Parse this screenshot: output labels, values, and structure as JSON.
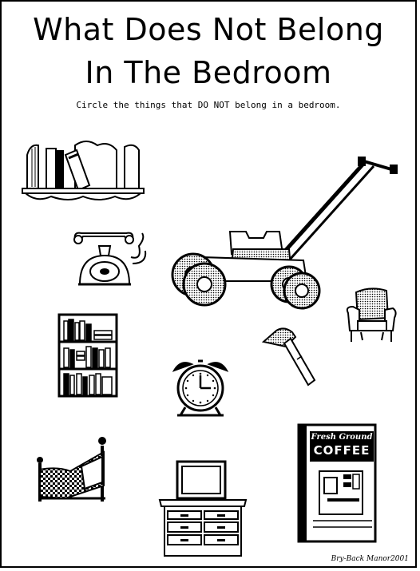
{
  "worksheet": {
    "title_line1": "What Does Not Belong",
    "title_line2": "In The Bedroom",
    "instruction": "Circle the things that DO NOT belong in a bedroom.",
    "credit": "Bry-Back Manor2001"
  },
  "items": [
    {
      "icon": "bookends-icon"
    },
    {
      "icon": "telephone-icon"
    },
    {
      "icon": "lawn-mower-icon"
    },
    {
      "icon": "armchair-icon"
    },
    {
      "icon": "bookshelf-icon"
    },
    {
      "icon": "hammer-icon"
    },
    {
      "icon": "alarm-clock-icon"
    },
    {
      "icon": "bed-icon"
    },
    {
      "icon": "dresser-icon"
    },
    {
      "icon": "coffee-machine-icon"
    }
  ],
  "coffee_machine": {
    "sign_line1": "Fresh Ground",
    "sign_line2": "COFFEE"
  },
  "colors": {
    "ink": "#000000",
    "paper": "#ffffff"
  }
}
